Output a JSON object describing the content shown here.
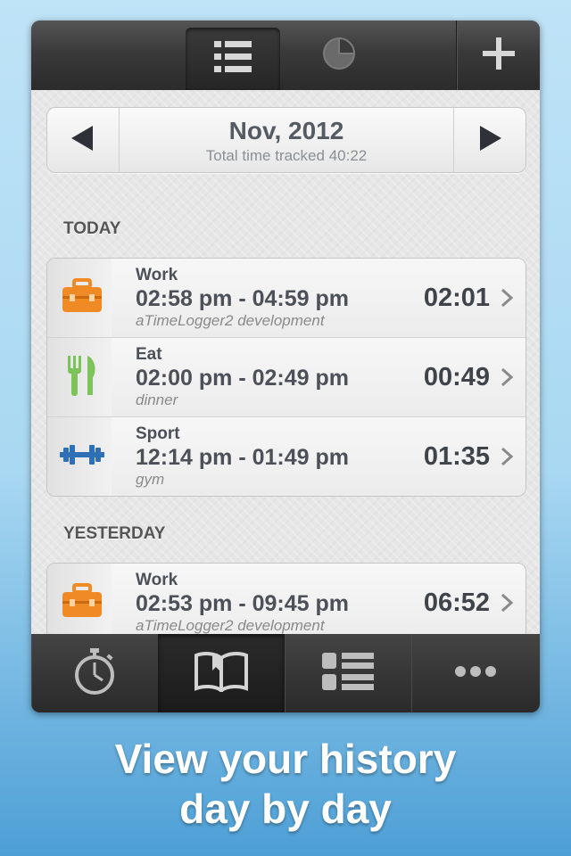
{
  "topbar": {
    "tabs": [
      {
        "icon": "list-icon"
      },
      {
        "icon": "pie-chart-icon"
      },
      {
        "icon": "plus-icon"
      }
    ]
  },
  "date_nav": {
    "title": "Nov, 2012",
    "subtitle": "Total time tracked 40:22",
    "prev_icon": "left-arrow-icon",
    "next_icon": "right-arrow-icon"
  },
  "sections": {
    "today": {
      "label": "TODAY",
      "entries": [
        {
          "type": "Work",
          "range": "02:58 pm - 04:59 pm",
          "note": "aTimeLogger2 development",
          "duration": "02:01",
          "icon": "toolbox-icon",
          "icon_color": "#f08a24"
        },
        {
          "type": "Eat",
          "range": "02:00 pm - 02:49 pm",
          "note": "dinner",
          "duration": "00:49",
          "icon": "fork-knife-icon",
          "icon_color": "#7cc35a"
        },
        {
          "type": "Sport",
          "range": "12:14 pm - 01:49 pm",
          "note": "gym",
          "duration": "01:35",
          "icon": "dumbbell-icon",
          "icon_color": "#2f6fb6"
        }
      ]
    },
    "yesterday": {
      "label": "YESTERDAY",
      "entries": [
        {
          "type": "Work",
          "range": "02:53 pm - 09:45 pm",
          "note": "aTimeLogger2 development",
          "duration": "06:52",
          "icon": "toolbox-icon",
          "icon_color": "#f08a24"
        }
      ]
    }
  },
  "tabbar": {
    "tabs": [
      {
        "icon": "stopwatch-icon"
      },
      {
        "icon": "book-icon"
      },
      {
        "icon": "list-icon"
      },
      {
        "icon": "more-icon"
      }
    ]
  },
  "caption": {
    "line1": "View your history",
    "line2": "day by day"
  }
}
